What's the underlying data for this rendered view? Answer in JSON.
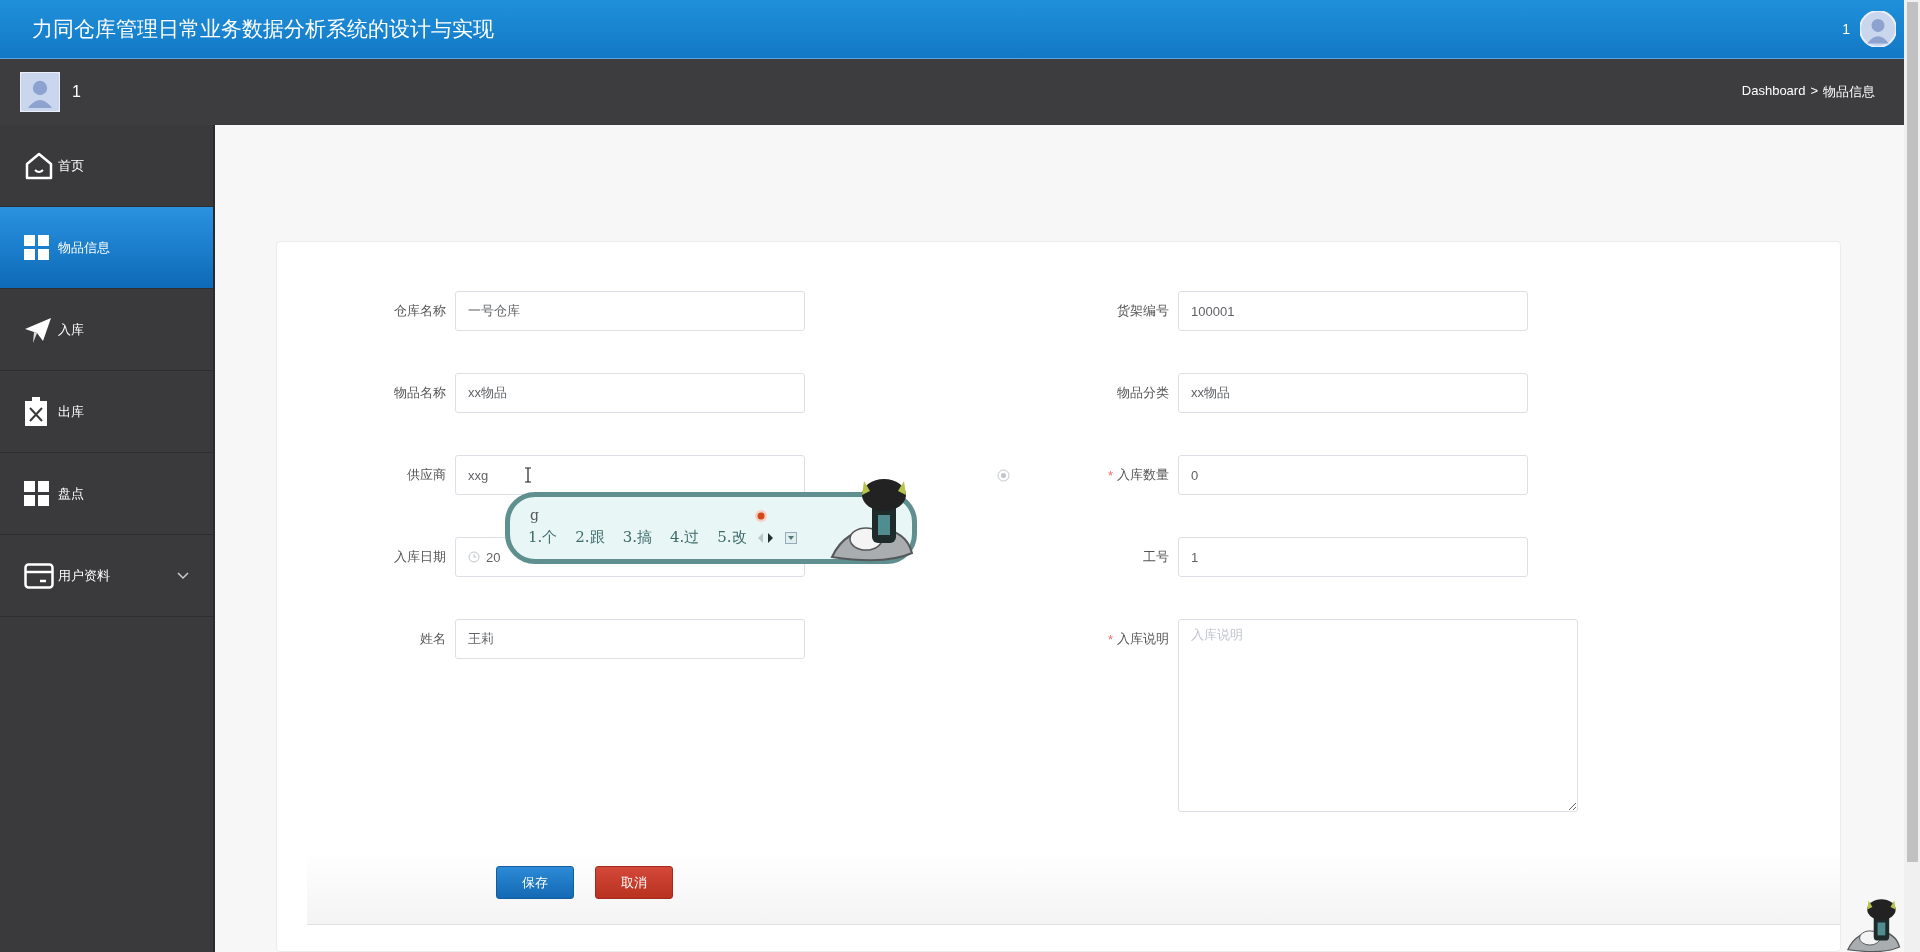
{
  "header": {
    "title": "力同仓库管理日常业务数据分析系统的设计与实现",
    "user": "1"
  },
  "userbar": {
    "username": "1",
    "breadcrumb": [
      {
        "label": "Dashboard"
      },
      {
        "label": "物品信息"
      }
    ],
    "separator": ">"
  },
  "sidebar": {
    "items": [
      {
        "label": "首页",
        "selected": false
      },
      {
        "label": "物品信息",
        "selected": true
      },
      {
        "label": "入库",
        "selected": false
      },
      {
        "label": "出库",
        "selected": false
      },
      {
        "label": "盘点",
        "selected": false
      },
      {
        "label": "用户资料",
        "selected": false,
        "expandable": true
      }
    ]
  },
  "form": {
    "required_mark": "*",
    "fields": [
      {
        "label": "仓库名称",
        "kind": "text",
        "value": "一号仓库",
        "required": false
      },
      {
        "label": "货架编号",
        "kind": "text",
        "value": "100001",
        "required": false
      },
      {
        "label": "物品名称",
        "kind": "text",
        "value": "xx物品",
        "required": false
      },
      {
        "label": "物品分类",
        "kind": "text",
        "value": "xx物品",
        "required": false
      },
      {
        "label": "供应商",
        "kind": "text",
        "value": "xxg",
        "required": false,
        "focused": true,
        "clearable": true
      },
      {
        "label": "入库数量",
        "kind": "text",
        "value": "0",
        "required": true
      },
      {
        "label": "入库日期",
        "kind": "date",
        "value": "20",
        "required": false
      },
      {
        "label": "工号",
        "kind": "text",
        "value": "1",
        "required": false
      },
      {
        "label": "姓名",
        "kind": "text",
        "value": "王莉",
        "required": false
      },
      {
        "label": "入库说明",
        "kind": "textarea",
        "placeholder": "入库说明",
        "required": true
      }
    ],
    "buttons": [
      {
        "label": "保存",
        "kind": "primary"
      },
      {
        "label": "取消",
        "kind": "danger"
      }
    ]
  },
  "ime": {
    "composition": "g",
    "candidates": [
      "1.个",
      "2.跟",
      "3.搞",
      "4.过",
      "5.改"
    ]
  }
}
